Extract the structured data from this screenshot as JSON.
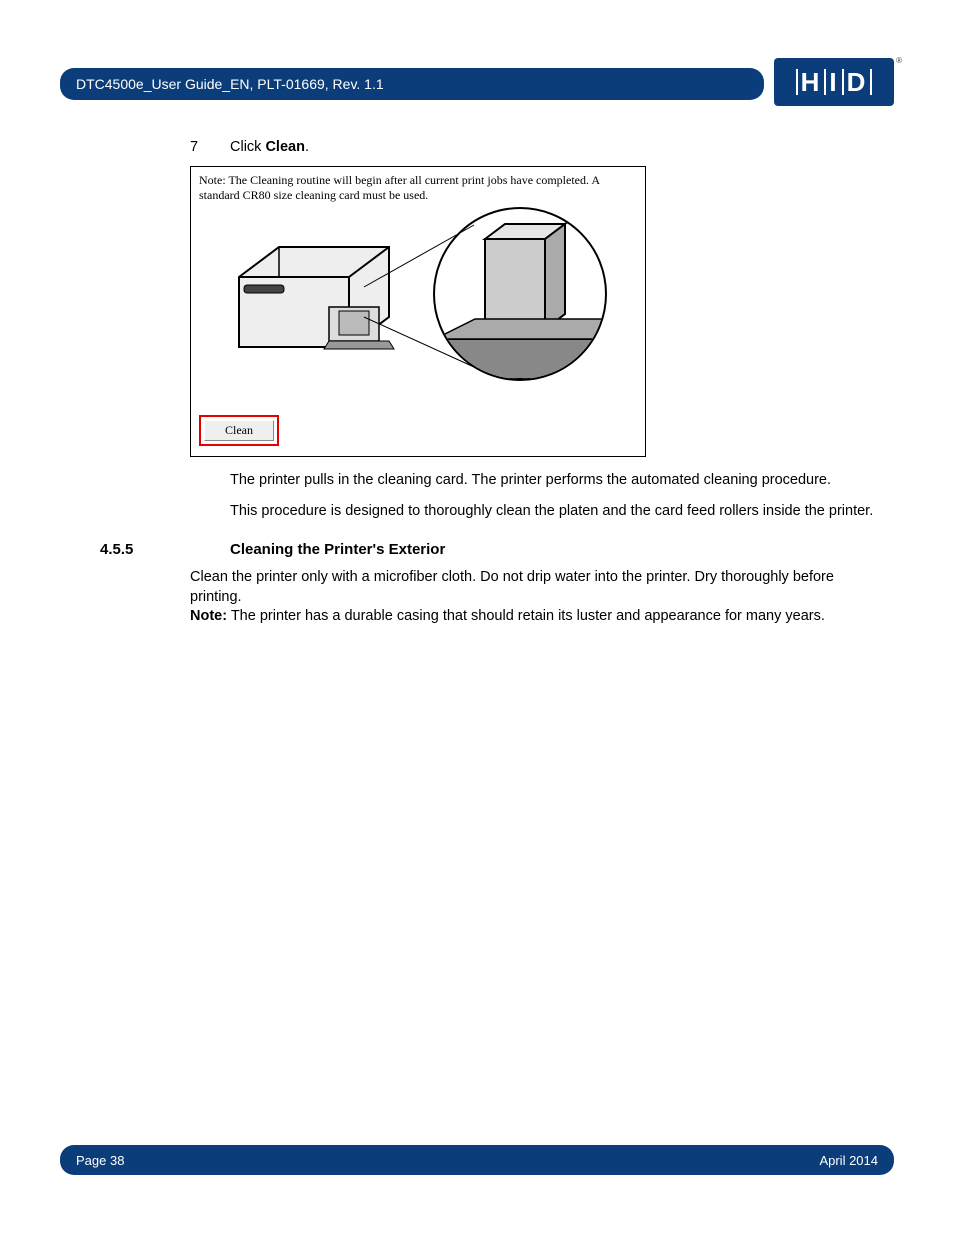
{
  "header": {
    "title": "DTC4500e_User Guide_EN, PLT-01669, Rev. 1.1",
    "logo_text": "HID"
  },
  "step": {
    "number": "7",
    "prefix": "Click ",
    "bold": "Clean",
    "suffix": "."
  },
  "dialog": {
    "note": "Note: The Cleaning routine will begin after all current print jobs have completed.  A standard CR80 size cleaning card must be used.",
    "button_label": "Clean"
  },
  "body": {
    "p1": "The printer pulls in the cleaning card. The printer performs the automated cleaning procedure.",
    "p2": "This procedure is designed to thoroughly clean the platen and the card feed rollers inside the printer."
  },
  "section": {
    "number": "4.5.5",
    "title": "Cleaning the Printer's Exterior",
    "p1": "Clean the printer only with a microfiber cloth. Do not drip water into the printer. Dry thoroughly before printing.",
    "note_label": "Note:",
    "note_text": " The printer has a durable casing that should retain its luster and appearance for many years."
  },
  "footer": {
    "page": "Page 38",
    "date": "April 2014"
  }
}
